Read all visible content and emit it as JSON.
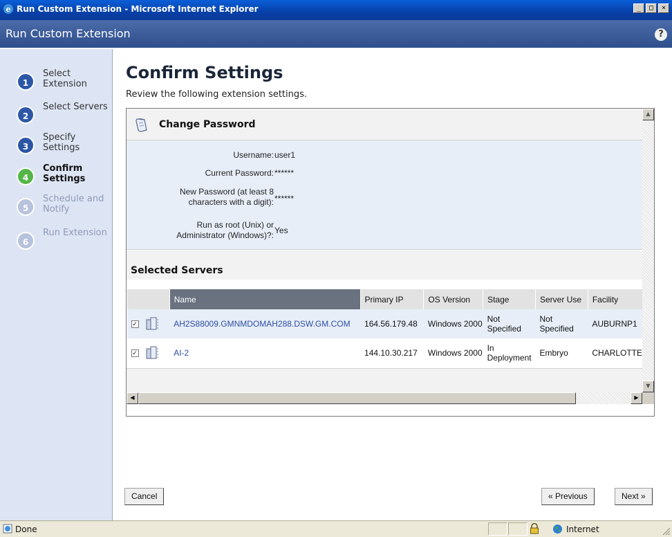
{
  "window": {
    "title": "Run Custom Extension - Microsoft Internet Explorer"
  },
  "app": {
    "title": "Run Custom Extension",
    "help": "?"
  },
  "steps": [
    {
      "num": "1",
      "label": "Select Extension",
      "state": "done"
    },
    {
      "num": "2",
      "label": "Select Servers",
      "state": "done"
    },
    {
      "num": "3",
      "label": "Specify Settings",
      "state": "done"
    },
    {
      "num": "4",
      "label": "Confirm Settings",
      "state": "current"
    },
    {
      "num": "5",
      "label": "Schedule and Notify",
      "state": "todo"
    },
    {
      "num": "6",
      "label": "Run Extension",
      "state": "todo"
    }
  ],
  "page": {
    "title": "Confirm Settings",
    "subtitle": "Review the following extension settings."
  },
  "change_password": {
    "title": "Change Password",
    "fields": [
      {
        "label": "Username:",
        "value": "user1"
      },
      {
        "label": "Current Password:",
        "value": "******"
      },
      {
        "label": "New Password (at least 8 characters with a digit):",
        "value": "******"
      },
      {
        "label": "Run as root (Unix) or Administrator (Windows)?:",
        "value": "Yes"
      }
    ]
  },
  "selected_servers": {
    "title": "Selected Servers",
    "columns": [
      "Name",
      "Primary IP",
      "OS Version",
      "Stage",
      "Server Use",
      "Facility"
    ],
    "rows": [
      {
        "name": "AH2S88009.GMNMDOMAH288.DSW.GM.COM",
        "ip": "164.56.179.48",
        "os": "Windows 2000",
        "stage": "Not Specified",
        "use": "Not Specified",
        "facility": "AUBURNP1",
        "checked": true
      },
      {
        "name": "AI-2",
        "ip": "144.10.30.217",
        "os": "Windows 2000",
        "stage": "In Deployment",
        "use": "Embryo",
        "facility": "CHARLOTTE",
        "checked": true
      }
    ]
  },
  "buttons": {
    "cancel": "Cancel",
    "previous": "« Previous",
    "next": "Next »"
  },
  "status": {
    "text": "Done",
    "zone": "Internet"
  },
  "colors": {
    "header": "#2f4f8c",
    "sidenav": "#dde5f4",
    "step_done": "#2d57a6",
    "step_current": "#55b548",
    "step_todo": "#b7c2dd",
    "link": "#2a4ea6"
  }
}
